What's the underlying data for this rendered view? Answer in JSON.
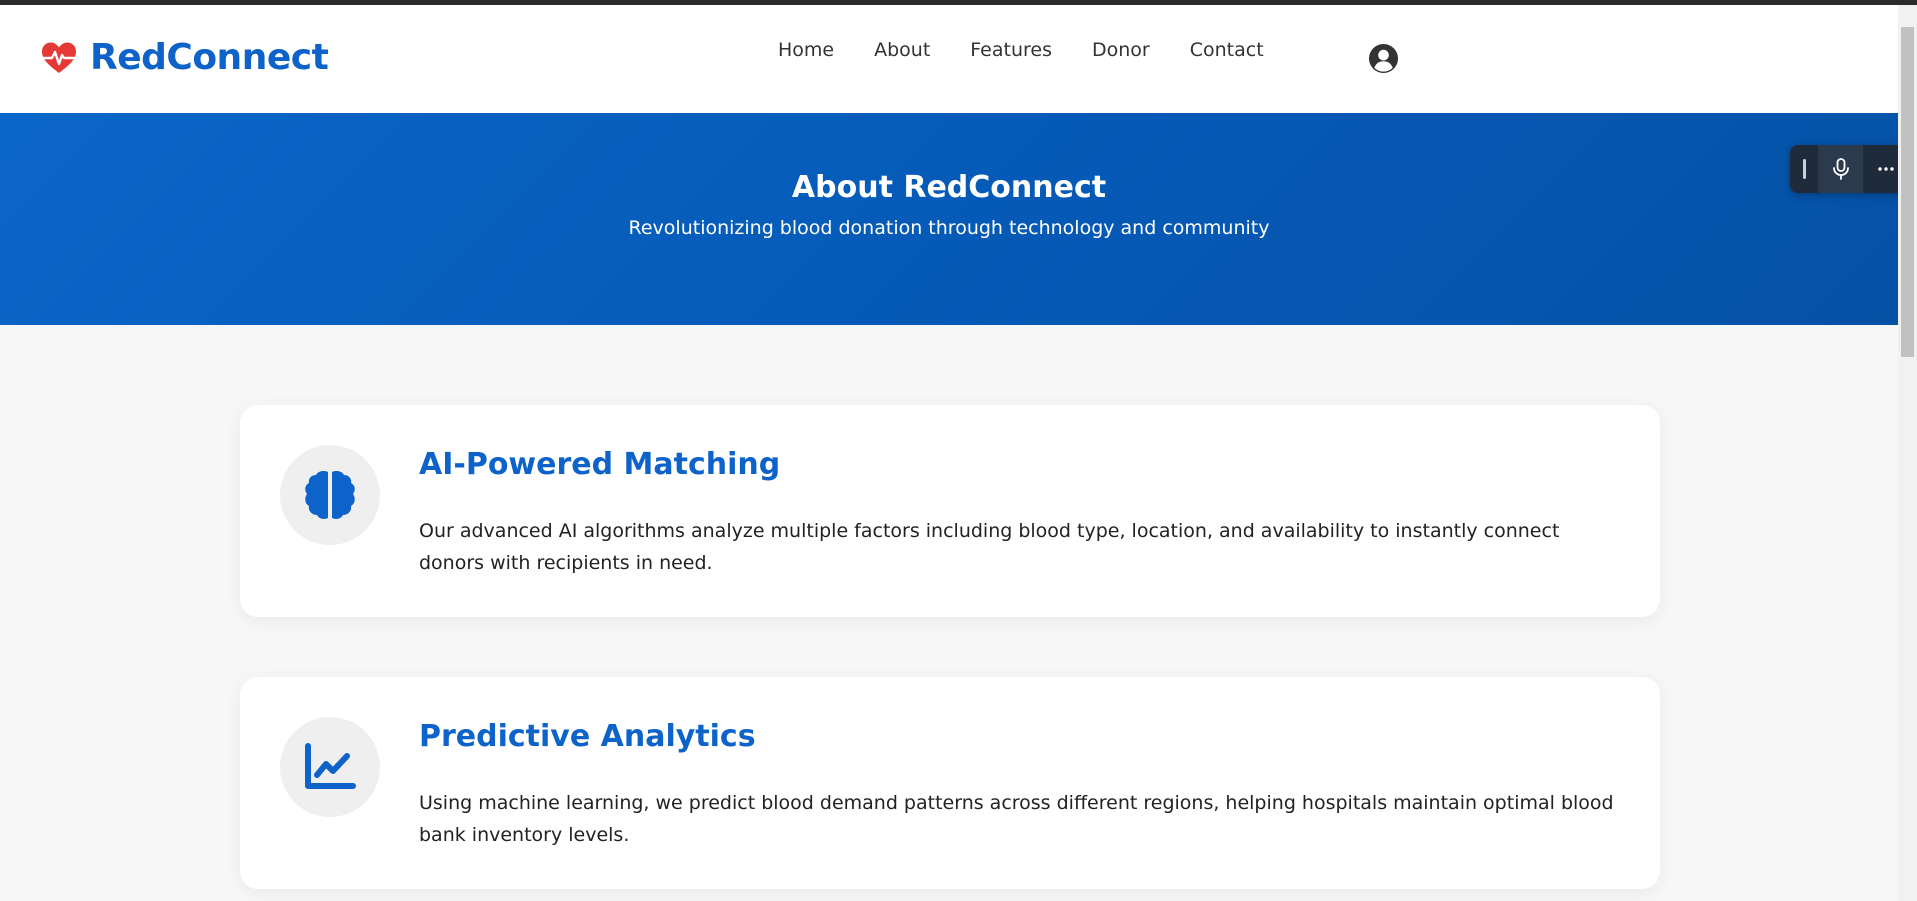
{
  "brand": {
    "name": "RedConnect",
    "color": "#0d63c9",
    "icon": "heart-pulse-icon",
    "icon_color": "#e53935"
  },
  "nav": {
    "links": [
      "Home",
      "About",
      "Features",
      "Donor",
      "Contact"
    ],
    "user_icon": "user-circle-icon"
  },
  "hero": {
    "title": "About RedConnect",
    "subtitle": "Revolutionizing blood donation through technology and community",
    "bg_color": "#0a66c8"
  },
  "features": [
    {
      "icon": "brain-icon",
      "title": "AI-Powered Matching",
      "text": "Our advanced AI algorithms analyze multiple factors including blood type, location, and availability to instantly connect donors with recipients in need."
    },
    {
      "icon": "line-chart-icon",
      "title": "Predictive Analytics",
      "text": "Using machine learning, we predict blood demand patterns across different regions, helping hospitals maintain optimal blood bank inventory levels."
    }
  ],
  "floating_toolbar": {
    "icons": [
      "grip-icon",
      "microphone-icon",
      "more-icon"
    ]
  }
}
